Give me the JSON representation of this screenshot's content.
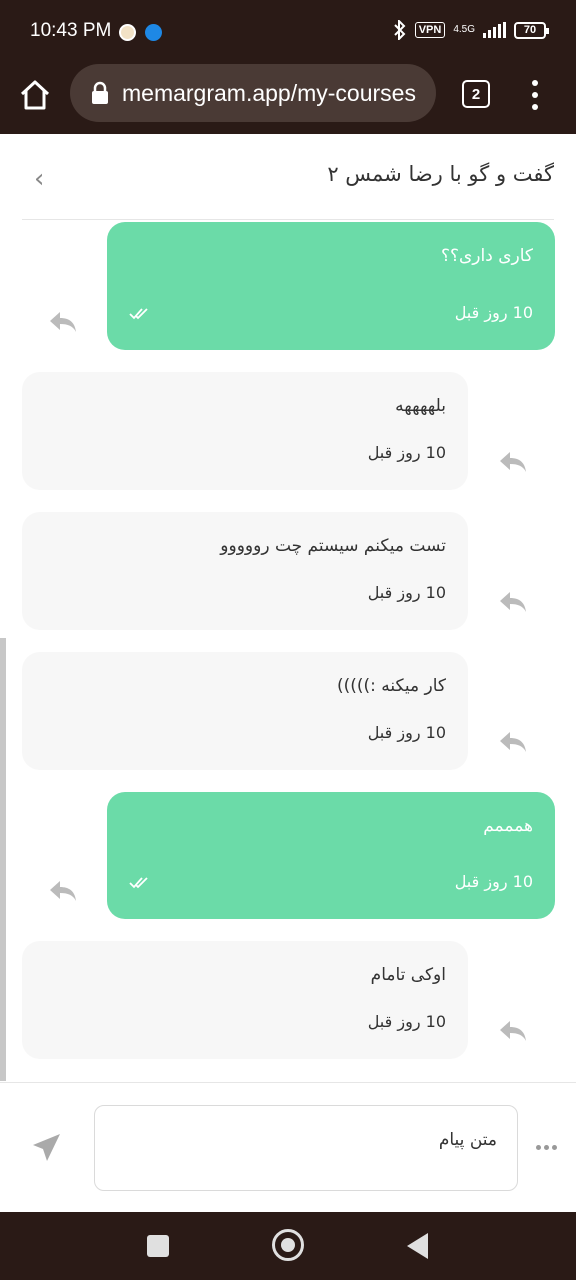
{
  "status_bar": {
    "time": "10:43 PM",
    "vpn": "VPN",
    "network": "4.5G",
    "battery": "70"
  },
  "browser": {
    "url": "memargram.app/my-courses",
    "tab_count": "2"
  },
  "chat": {
    "title": "گفت و گو با رضا شمس ۲",
    "back_icon": "chevron-left-icon"
  },
  "messages": [
    {
      "direction": "outgoing",
      "text": "کاری داری؟؟",
      "time": "10 روز قبل",
      "read": true
    },
    {
      "direction": "incoming",
      "text": "بلههههه",
      "time": "10 روز قبل"
    },
    {
      "direction": "incoming",
      "text": "تست میکنم سیستم چت رووووو",
      "time": "10 روز قبل"
    },
    {
      "direction": "incoming",
      "text": "کار میکنه :)))))",
      "time": "10 روز قبل"
    },
    {
      "direction": "outgoing",
      "text": "همممم",
      "time": "10 روز قبل",
      "read": true
    },
    {
      "direction": "incoming",
      "text": "اوکی تامام",
      "time": "10 روز قبل"
    }
  ],
  "input": {
    "placeholder": "متن پیام",
    "value": ""
  },
  "colors": {
    "outgoing_bubble": "#6bdba8",
    "incoming_bubble": "#f7f7f7",
    "system_bar": "#2a1a16"
  }
}
